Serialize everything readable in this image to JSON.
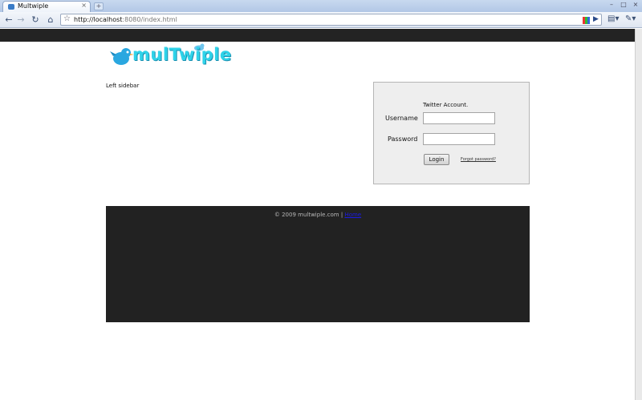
{
  "browser": {
    "tab_title": "Multwiple",
    "tab_close": "×",
    "newtab": "+",
    "url_host": "http://localhost",
    "url_rest": ":8080/index.html",
    "controls": {
      "minimize": "–",
      "maximize": "□",
      "close": "×"
    }
  },
  "header": {
    "logo_text": "mulTwiple"
  },
  "sidebar": {
    "label": "Left sidebar"
  },
  "login": {
    "title": "Twitter Account.",
    "username_label": "Username",
    "password_label": "Password",
    "username_value": "",
    "password_value": "",
    "login_button": "Login",
    "forgot_link": "Forgot password?"
  },
  "footer": {
    "copyright": "© 2009 multwiple.com |",
    "link": "Home"
  },
  "colors": {
    "logo": "#2fd3e9",
    "footer_bg": "#222222",
    "topbar": "#232323"
  }
}
